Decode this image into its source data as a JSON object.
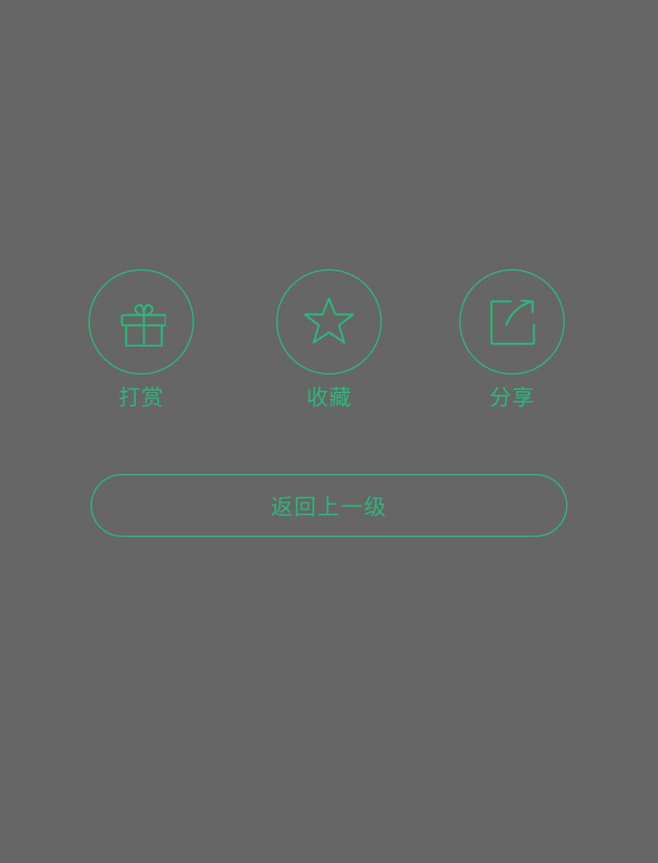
{
  "actions": [
    {
      "label": "打赏",
      "icon": "gift-icon"
    },
    {
      "label": "收藏",
      "icon": "star-icon"
    },
    {
      "label": "分享",
      "icon": "share-icon"
    }
  ],
  "back_button": {
    "label": "返回上一级"
  },
  "colors": {
    "background": "#666666",
    "accent": "#2db67c"
  }
}
